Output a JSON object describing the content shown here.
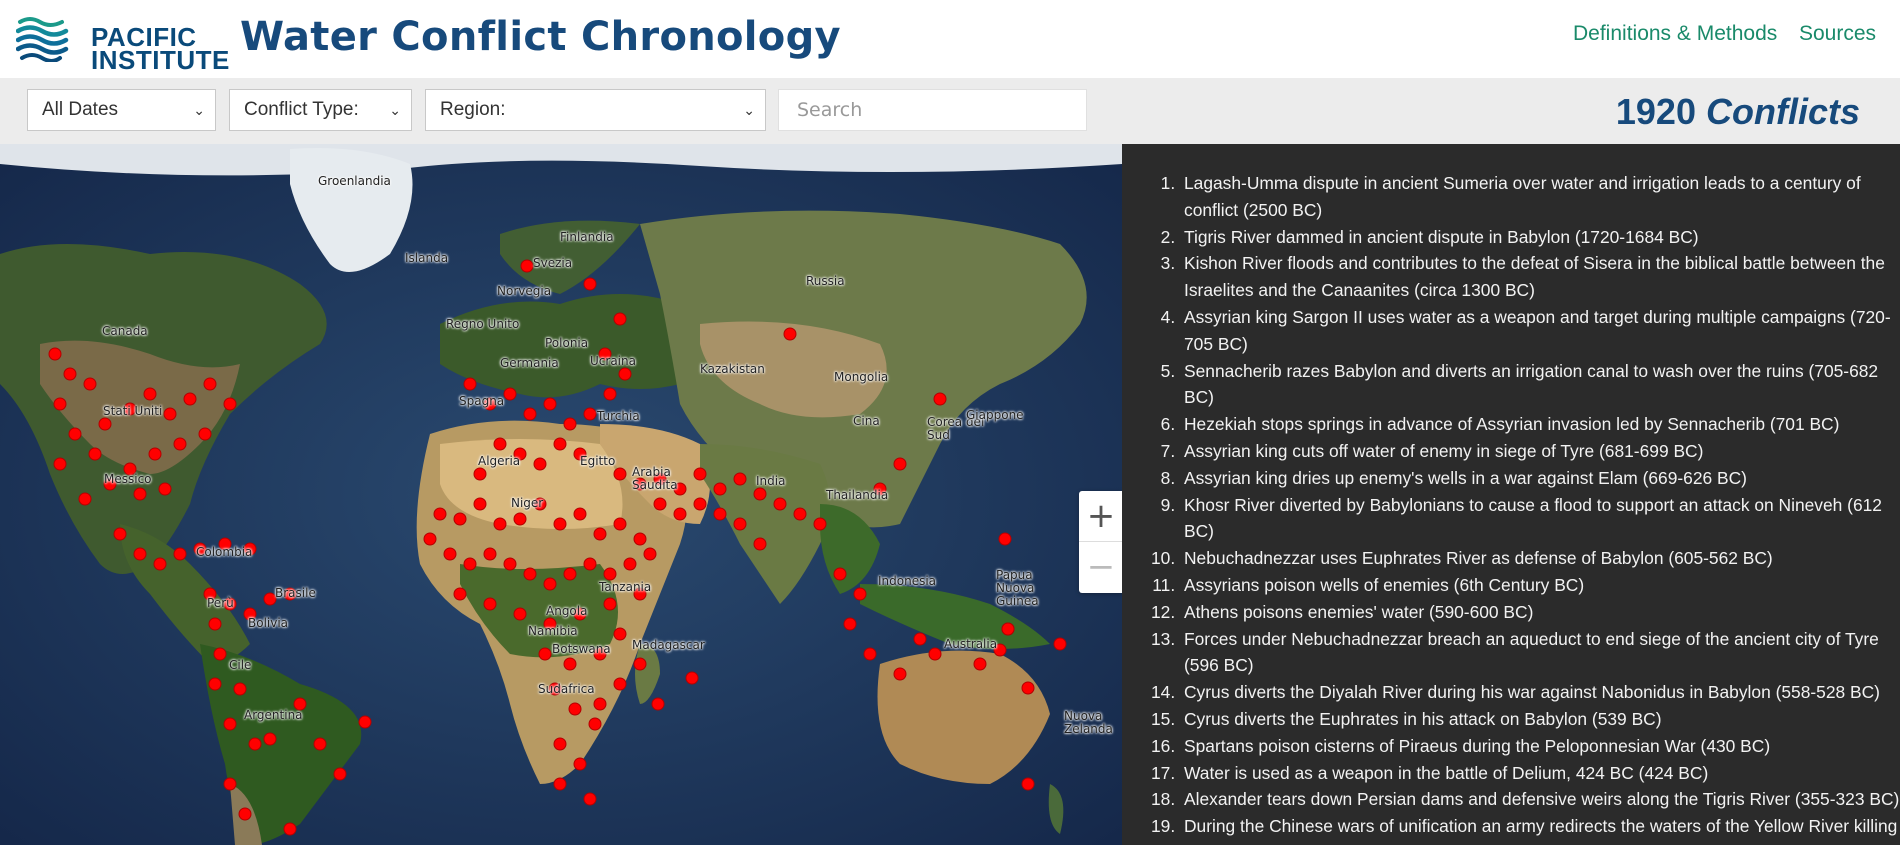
{
  "brand": {
    "line1": "PACIFIC",
    "line2": "INSTITUTE"
  },
  "app_title": "Water Conflict Chronology",
  "nav": [
    {
      "label": "Definitions & Methods"
    },
    {
      "label": "Sources"
    }
  ],
  "filters": {
    "dates": "All Dates",
    "conflict_type": "Conflict Type:",
    "region": "Region:",
    "search_placeholder": "Search"
  },
  "count": {
    "number": "1920",
    "label": "Conflicts"
  },
  "map": {
    "labels": [
      "Groenlandia",
      "Islanda",
      "Svezia",
      "Finlandia",
      "Norvegia",
      "Russia",
      "Canada",
      "Regno Unito",
      "Polonia",
      "Germania",
      "Ucraina",
      "Kazakistan",
      "Mongolia",
      "Spagna",
      "Stati Uniti",
      "Turchia",
      "Cina",
      "Corea del Sud",
      "Giappone",
      "Messico",
      "Algeria",
      "Egitto",
      "Arabia Saudita",
      "India",
      "Thailandia",
      "Niger",
      "Colombia",
      "Brasile",
      "Perù",
      "Bolivia",
      "Cile",
      "Argentina",
      "Tanzania",
      "Angola",
      "Namibia",
      "Botswana",
      "Sudafrica",
      "Madagascar",
      "Indonesia",
      "Papua Nuova Guinea",
      "Australia",
      "Nuova Zelanda"
    ],
    "marker_color": "#ff0000",
    "zoom_in": "+",
    "zoom_out": "−"
  },
  "conflicts": [
    "Lagash-Umma dispute in ancient Sumeria over water and irrigation leads to a century of conflict (2500 BC)",
    "Tigris River dammed in ancient dispute in Babylon (1720-1684 BC)",
    "Kishon River floods and contributes to the defeat of Sisera in the biblical battle between the Israelites and the Canaanites (circa 1300 BC)",
    "Assyrian king Sargon II uses water as a weapon and target during multiple campaigns (720-705 BC)",
    "Sennacherib razes Babylon and diverts an irrigation canal to wash over the ruins (705-682 BC)",
    "Hezekiah stops springs in advance of Assyrian invasion led by Sennacherib (701 BC)",
    "Assyrian king cuts off water of enemy in siege of Tyre (681-699 BC)",
    "Assyrian king dries up enemy's wells in a war against Elam (669-626 BC)",
    "Khosr River diverted by Babylonians to cause a flood to support an attack on Nineveh (612 BC)",
    "Nebuchadnezzar uses Euphrates River as defense of Babylon (605-562 BC)",
    "Assyrians poison wells of enemies (6th Century BC)",
    "Athens poisons enemies' water (590-600 BC)",
    "Forces under Nebuchadnezzar breach an aqueduct to end siege of the ancient city of Tyre (596 BC)",
    "Cyrus diverts the Diyalah River during his war against Nabonidus in Babylon (558-528 BC)",
    "Cyrus diverts the Euphrates in his attack on Babylon (539 BC)",
    "Spartans poison cisterns of Piraeus during the Peloponnesian War (430 BC)",
    "Water is used as a weapon in the battle of Delium, 424 BC (424 BC)",
    "Alexander tears down Persian dams and defensive weirs along the Tigris River (355-323 BC)",
    "During the Chinese wars of unification an army redirects the waters of the Yellow River killing"
  ]
}
